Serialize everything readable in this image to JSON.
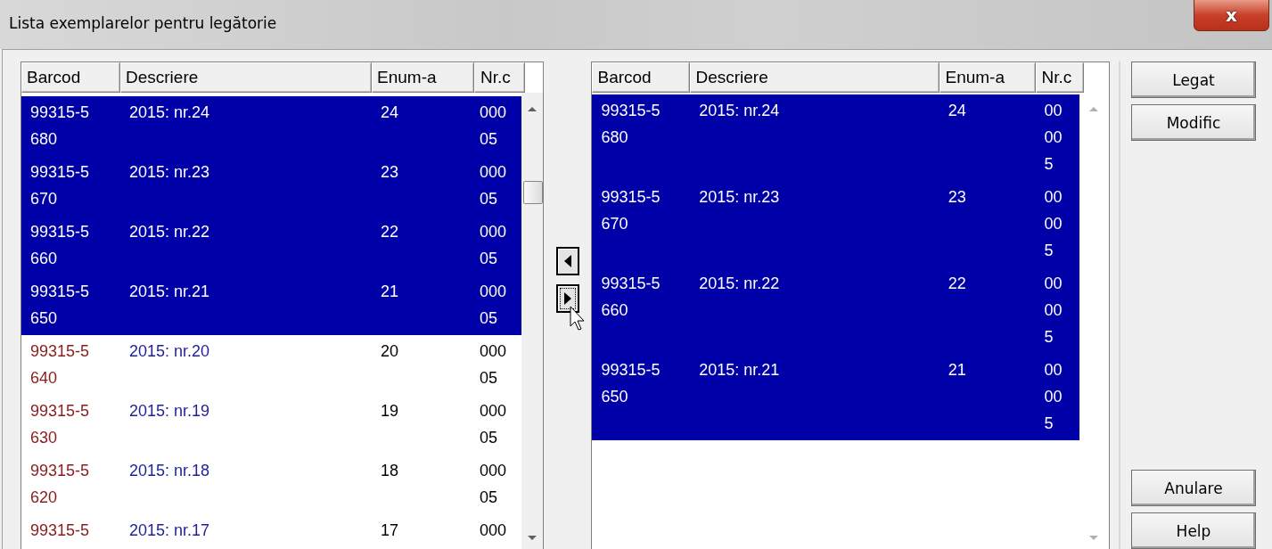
{
  "window": {
    "title": "Lista exemplarelor pentru legătorie",
    "close": "x"
  },
  "left_list": {
    "columns": [
      "Barcod",
      "Descriere",
      "Enum-a",
      "Nr.c"
    ],
    "rows": [
      {
        "barcode": "99315-5680",
        "description": "2015: nr.24",
        "enum": "24",
        "nr": "00005",
        "selected": true
      },
      {
        "barcode": "99315-5670",
        "description": "2015: nr.23",
        "enum": "23",
        "nr": "00005",
        "selected": true
      },
      {
        "barcode": "99315-5660",
        "description": "2015: nr.22",
        "enum": "22",
        "nr": "00005",
        "selected": true
      },
      {
        "barcode": "99315-5650",
        "description": "2015: nr.21",
        "enum": "21",
        "nr": "00005",
        "selected": true
      },
      {
        "barcode": "99315-5640",
        "description": "2015: nr.20",
        "enum": "20",
        "nr": "00005",
        "selected": false
      },
      {
        "barcode": "99315-5630",
        "description": "2015: nr.19",
        "enum": "19",
        "nr": "00005",
        "selected": false
      },
      {
        "barcode": "99315-5620",
        "description": "2015: nr.18",
        "enum": "18",
        "nr": "00005",
        "selected": false
      },
      {
        "barcode": "99315-5",
        "description": "2015: nr.17",
        "enum": "17",
        "nr": "000",
        "selected": false
      }
    ]
  },
  "right_list": {
    "columns": [
      "Barcod",
      "Descriere",
      "Enum-a",
      "Nr.c"
    ],
    "rows": [
      {
        "barcode": "99315-5680",
        "description": "2015: nr.24",
        "enum": "24",
        "nr": "00005",
        "selected": true
      },
      {
        "barcode": "99315-5670",
        "description": "2015: nr.23",
        "enum": "23",
        "nr": "00005",
        "selected": true
      },
      {
        "barcode": "99315-5660",
        "description": "2015: nr.22",
        "enum": "22",
        "nr": "00005",
        "selected": true
      },
      {
        "barcode": "99315-5650",
        "description": "2015: nr.21",
        "enum": "21",
        "nr": "00005",
        "selected": true
      }
    ]
  },
  "buttons_top": [
    "Legat",
    "Modific"
  ],
  "buttons_bottom": [
    "Anulare",
    "Help"
  ]
}
